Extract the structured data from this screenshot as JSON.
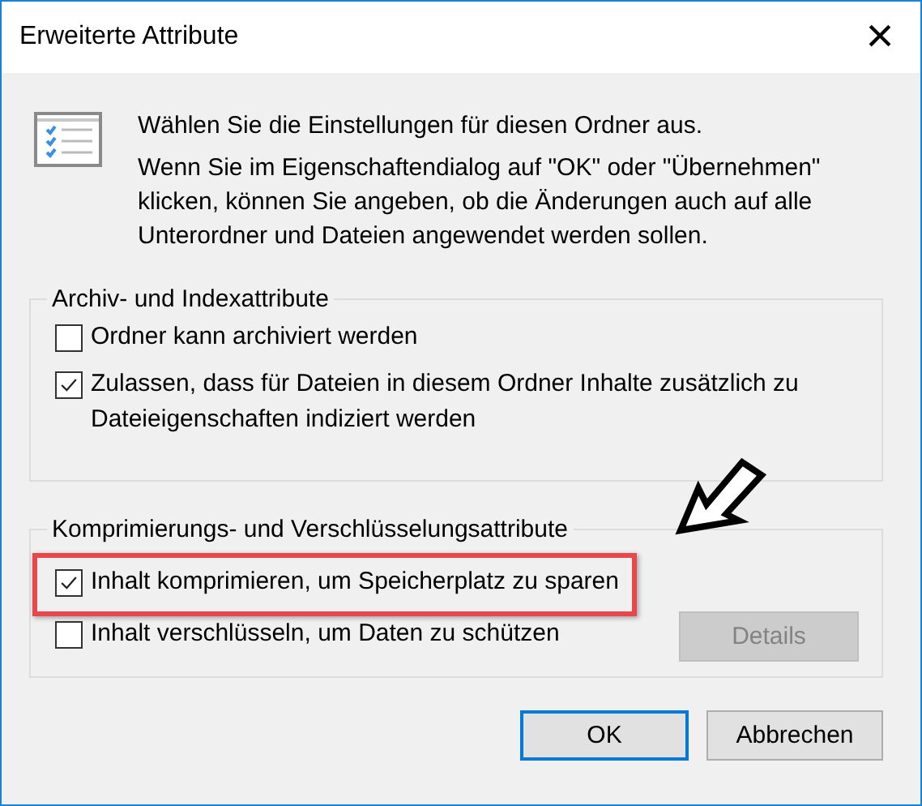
{
  "window": {
    "title": "Erweiterte Attribute",
    "close": "×"
  },
  "intro": {
    "heading": "Wählen Sie die Einstellungen für diesen Ordner aus.",
    "text": "Wenn Sie im Eigenschaftendialog auf \"OK\" oder \"Übernehmen\" klicken, können Sie angeben, ob die Änderungen auch auf alle Unterordner und Dateien angewendet werden sollen."
  },
  "groups": [
    {
      "title": "Archiv- und Indexattribute",
      "options": [
        {
          "label": "Ordner kann archiviert werden",
          "checked": false,
          "highlighted": false
        },
        {
          "label": "Zulassen, dass für Dateien in diesem Ordner Inhalte zusätzlich zu Dateieigenschaften indiziert werden",
          "checked": true,
          "highlighted": false
        }
      ]
    },
    {
      "title": "Komprimierungs- und Verschlüsselungsattribute",
      "options": [
        {
          "label": "Inhalt komprimieren, um Speicherplatz zu sparen",
          "checked": true,
          "highlighted": true
        },
        {
          "label": "Inhalt verschlüsseln, um Daten zu schützen",
          "checked": false,
          "highlighted": false
        }
      ],
      "button": {
        "label": "Details",
        "disabled": true
      }
    }
  ],
  "buttons": [
    {
      "label": "OK",
      "default": true
    },
    {
      "label": "Abbrechen",
      "default": false
    }
  ]
}
